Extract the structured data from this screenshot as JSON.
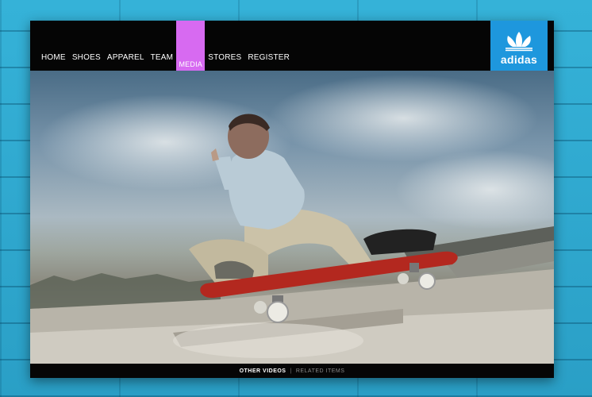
{
  "nav": {
    "items": [
      {
        "label": "HOME"
      },
      {
        "label": "SHOES"
      },
      {
        "label": "APPAREL"
      },
      {
        "label": "TEAM"
      },
      {
        "label": "MEDIA"
      },
      {
        "label": "STORES"
      },
      {
        "label": "REGISTER"
      }
    ],
    "active_index": 4,
    "active_color": "#d76af1"
  },
  "brand": {
    "wordmark": "adidas",
    "logo_icon": "trefoil-icon",
    "color": "#1e97dd"
  },
  "video": {
    "content": "skateboarder-photo"
  },
  "footer": {
    "other_videos": "OTHER VIDEOS",
    "separator": "|",
    "related_items": "RELATED ITEMS"
  }
}
